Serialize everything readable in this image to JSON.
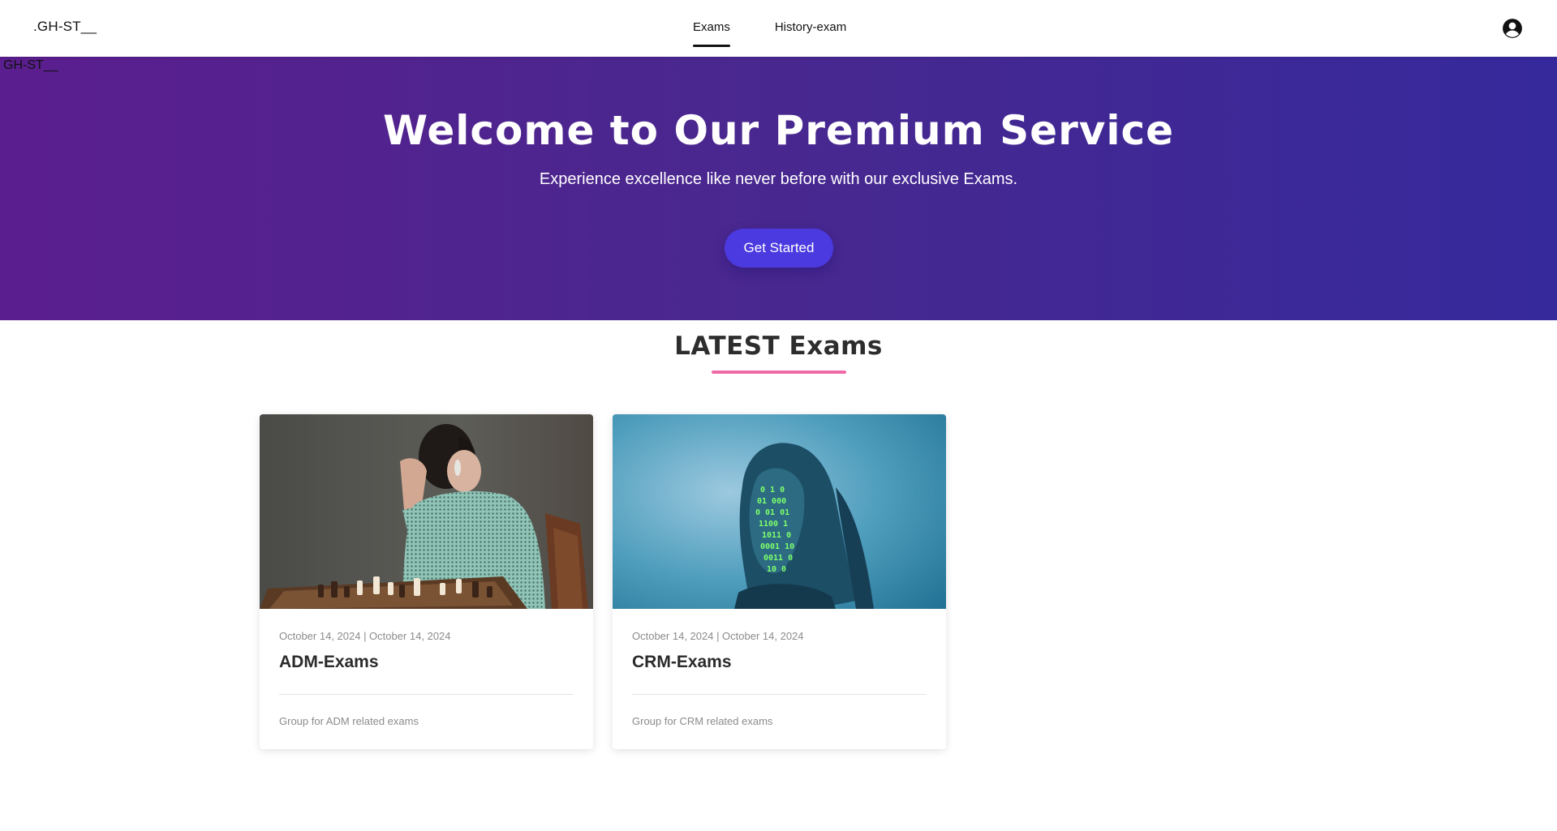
{
  "header": {
    "brand": ".GH-ST__",
    "tabs": [
      {
        "label": "Exams",
        "active": true
      },
      {
        "label": "History-exam",
        "active": false
      }
    ],
    "profile_icon": "user-circle-icon"
  },
  "brand_overlay": "GH-ST__",
  "hero": {
    "title": "Welcome to Our Premium Service",
    "subtitle": "Experience excellence like never before with our exclusive Exams.",
    "cta_label": "Get Started",
    "gradient_colors": [
      "#5b1e8e",
      "#36299c"
    ],
    "cta_color": "#4b3ae0"
  },
  "latest": {
    "title": "LATEST Exams",
    "underline_color": "#ee6aa7"
  },
  "cards": [
    {
      "image": "woman-playing-chess-photo",
      "date": "October 14, 2024 | October 14, 2024",
      "title": "ADM-Exams",
      "description": "Group for ADM related exams"
    },
    {
      "image": "woman-binary-code-projection-photo",
      "date": "October 14, 2024 | October 14, 2024",
      "title": "CRM-Exams",
      "description": "Group for CRM related exams"
    }
  ]
}
